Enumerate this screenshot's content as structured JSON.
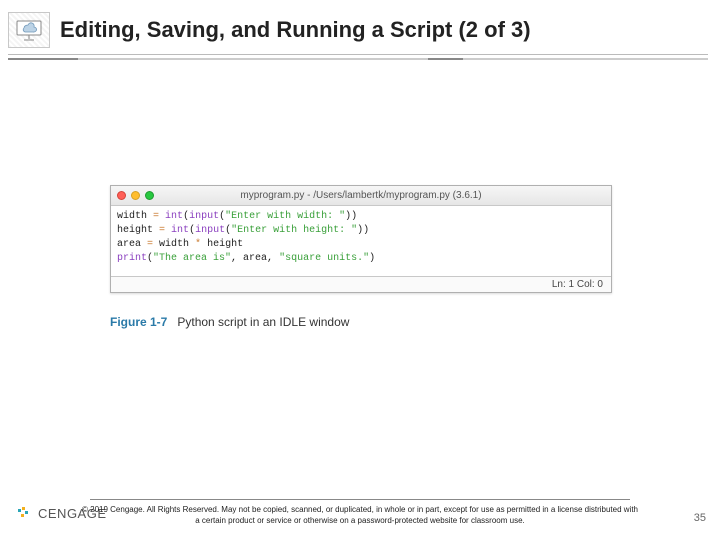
{
  "header": {
    "title": "Editing, Saving, and Running a Script (2 of 3)"
  },
  "idle": {
    "window_title": "myprogram.py - /Users/lambertk/myprogram.py (3.6.1)",
    "status": "Ln: 1   Col: 0",
    "code": {
      "line1": {
        "a": "width ",
        "b": "=",
        "c": " ",
        "d": "int",
        "e": "(",
        "f": "input",
        "g": "(",
        "h": "\"Enter with width: \"",
        "i": "))"
      },
      "line2": {
        "a": "height ",
        "b": "=",
        "c": " ",
        "d": "int",
        "e": "(",
        "f": "input",
        "g": "(",
        "h": "\"Enter with height: \"",
        "i": "))"
      },
      "line3": {
        "a": "area ",
        "b": "=",
        "c": " width ",
        "d": "*",
        "e": " height"
      },
      "line4": {
        "a": "print",
        "b": "(",
        "c": "\"The area is\"",
        "d": ", area, ",
        "e": "\"square units.\"",
        "f": ")"
      }
    }
  },
  "figure": {
    "label": "Figure 1-7",
    "caption": "Python script in an IDLE window"
  },
  "footer": {
    "copyright": "© 2019 Cengage. All Rights Reserved. May not be copied, scanned, or duplicated, in whole or in part, except for use as permitted in a license distributed with a certain product or service or otherwise on a password-protected website for classroom use."
  },
  "brand": {
    "name": "CENGAGE"
  },
  "page_number": "35"
}
